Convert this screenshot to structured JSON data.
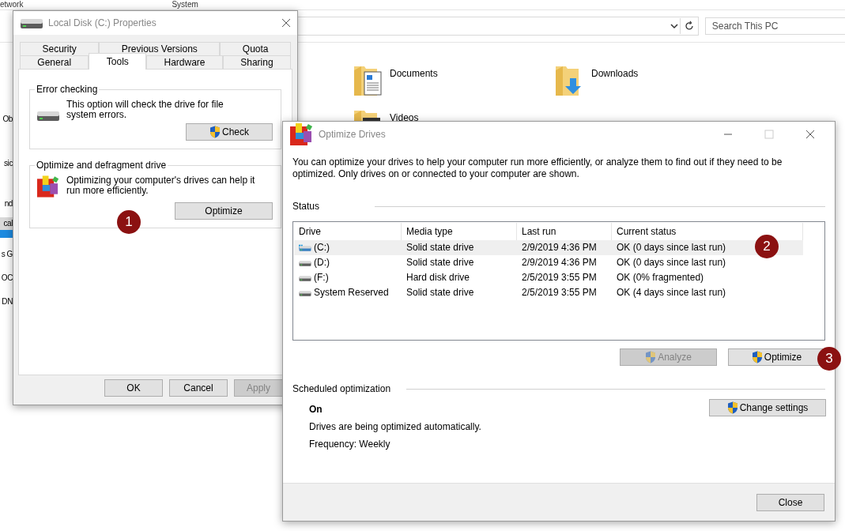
{
  "explorer": {
    "header_columns": [
      "etwork",
      "System"
    ],
    "sidebar_fragments": [
      {
        "text": "Ob",
        "selected": false
      },
      {
        "text": "sic",
        "selected": false
      },
      {
        "text": "nd",
        "selected": false
      },
      {
        "text": "cal",
        "selected": true
      },
      {
        "text": "s G",
        "selected": false
      },
      {
        "text": "OC",
        "selected": false
      },
      {
        "text": "DN",
        "selected": false
      }
    ],
    "search": {
      "placeholder": "Search This PC"
    },
    "folders": [
      {
        "name": "Documents",
        "kind": "documents"
      },
      {
        "name": "Downloads",
        "kind": "downloads"
      },
      {
        "name": "Videos",
        "kind": "videos"
      }
    ]
  },
  "properties_dialog": {
    "title": "Local Disk (C:) Properties",
    "tab_rows": [
      {
        "tabs": [
          {
            "label": "Security",
            "selected": false
          },
          {
            "label": "Previous Versions",
            "selected": false
          },
          {
            "label": "Quota",
            "selected": false
          }
        ]
      },
      {
        "tabs": [
          {
            "label": "General",
            "selected": false
          },
          {
            "label": "Tools",
            "selected": true
          },
          {
            "label": "Hardware",
            "selected": false
          },
          {
            "label": "Sharing",
            "selected": false
          }
        ]
      }
    ],
    "groups": [
      {
        "title": "Error checking",
        "kind": "drive",
        "description": "This option will check the drive for file system errors.",
        "button": {
          "label": "Check",
          "shield": true
        }
      },
      {
        "title": "Optimize and defragment drive",
        "kind": "defrag",
        "description": "Optimizing your computer's drives can help it run more efficiently.",
        "button": {
          "label": "Optimize",
          "shield": false
        }
      }
    ],
    "buttons": [
      {
        "label": "OK",
        "disabled": false
      },
      {
        "label": "Cancel",
        "disabled": false
      },
      {
        "label": "Apply",
        "disabled": true
      }
    ]
  },
  "optimize_dialog": {
    "title": "Optimize Drives",
    "description": "You can optimize your drives to help your computer run more efficiently, or analyze them to find out if they need to be optimized. Only drives on or connected to your computer are shown.",
    "status_label": "Status",
    "columns": [
      "Drive",
      "Media type",
      "Last run",
      "Current status"
    ],
    "drives": [
      {
        "drive": "(C:)",
        "kind": "system",
        "media_type": "Solid state drive",
        "last_run": "2/9/2019 4:36 PM",
        "current_status": "OK (0 days since last run)",
        "selected": true
      },
      {
        "drive": "(D:)",
        "kind": "drive",
        "media_type": "Solid state drive",
        "last_run": "2/9/2019 4:36 PM",
        "current_status": "OK (0 days since last run)",
        "selected": false
      },
      {
        "drive": "(F:)",
        "kind": "drive",
        "media_type": "Hard disk drive",
        "last_run": "2/5/2019 3:55 PM",
        "current_status": "OK (0% fragmented)",
        "selected": false
      },
      {
        "drive": "System Reserved",
        "kind": "drive",
        "media_type": "Solid state drive",
        "last_run": "2/5/2019 3:55 PM",
        "current_status": "OK (4 days since last run)",
        "selected": false
      }
    ],
    "actions": [
      {
        "label": "Analyze",
        "disabled": true
      },
      {
        "label": "Optimize",
        "disabled": false
      }
    ],
    "schedule": {
      "heading": "Scheduled optimization",
      "state": "On",
      "summary": "Drives are being optimized automatically.",
      "frequency": "Frequency: Weekly",
      "button": "Change settings"
    },
    "close": "Close"
  },
  "callouts": [
    "1",
    "2",
    "3"
  ]
}
